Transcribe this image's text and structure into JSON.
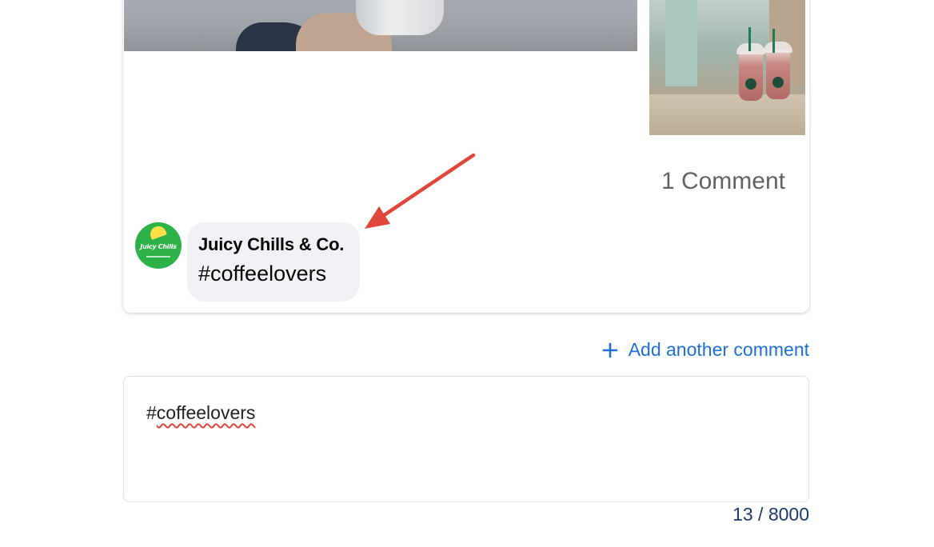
{
  "post": {
    "comment_count": "1 Comment",
    "comment": {
      "author": "Juicy Chills & Co.",
      "text": "#coffeelovers",
      "avatar_label": "Juicy Chills"
    }
  },
  "compose": {
    "add_another_label": "Add another comment",
    "input_value_prefix": "#",
    "input_value_word": "coffeelovers",
    "counter": "13 / 8000"
  },
  "colors": {
    "link": "#1f6fd6",
    "annotation_arrow": "#e0463a",
    "bubble": "#f0f2f5",
    "avatar": "#2db24a"
  },
  "icons": {
    "add": "plus-icon",
    "annotation": "arrow-icon"
  }
}
